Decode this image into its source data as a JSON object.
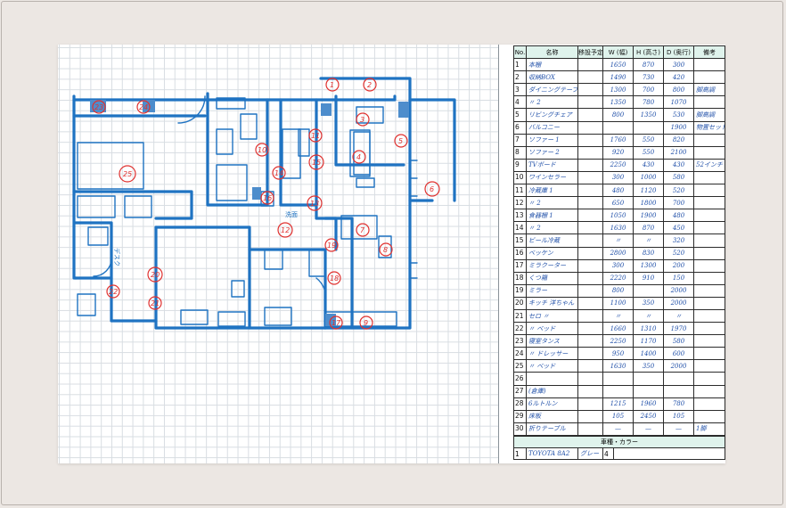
{
  "furniture_table": {
    "headers": [
      "No.",
      "名称",
      "移設予定",
      "W (幅)",
      "H (高さ)",
      "D (奥行)",
      "備考"
    ],
    "rows": [
      {
        "no": "1",
        "name": "本棚",
        "plan": "",
        "w": "1650",
        "h": "870",
        "d": "300",
        "note": ""
      },
      {
        "no": "2",
        "name": "収納BOX",
        "plan": "",
        "w": "1490",
        "h": "730",
        "d": "420",
        "note": ""
      },
      {
        "no": "3",
        "name": "ダイニングテーブル1",
        "plan": "",
        "w": "1300",
        "h": "700",
        "d": "800",
        "note": "脚高調"
      },
      {
        "no": "4",
        "name": "〃 2",
        "plan": "",
        "w": "1350",
        "h": "780",
        "d": "1070",
        "note": ""
      },
      {
        "no": "5",
        "name": "リビングチェア",
        "plan": "",
        "w": "800",
        "h": "1350",
        "d": "530",
        "note": "脚高調"
      },
      {
        "no": "6",
        "name": "バルコニー",
        "plan": "",
        "w": "",
        "h": "",
        "d": "1900",
        "note": "物置セット"
      },
      {
        "no": "7",
        "name": "ソファー 1",
        "plan": "",
        "w": "1760",
        "h": "550",
        "d": "820",
        "note": ""
      },
      {
        "no": "8",
        "name": "ソファー 2",
        "plan": "",
        "w": "920",
        "h": "550",
        "d": "2100",
        "note": ""
      },
      {
        "no": "9",
        "name": "TVボード",
        "plan": "",
        "w": "2250",
        "h": "430",
        "d": "430",
        "note": "52インチ"
      },
      {
        "no": "10",
        "name": "ワインセラー",
        "plan": "",
        "w": "300",
        "h": "1000",
        "d": "580",
        "note": ""
      },
      {
        "no": "11",
        "name": "冷蔵庫 1",
        "plan": "",
        "w": "480",
        "h": "1120",
        "d": "520",
        "note": ""
      },
      {
        "no": "12",
        "name": "〃 2",
        "plan": "",
        "w": "650",
        "h": "1800",
        "d": "700",
        "note": ""
      },
      {
        "no": "13",
        "name": "食器棚 1",
        "plan": "",
        "w": "1050",
        "h": "1900",
        "d": "480",
        "note": ""
      },
      {
        "no": "14",
        "name": "〃 2",
        "plan": "",
        "w": "1630",
        "h": "870",
        "d": "450",
        "note": ""
      },
      {
        "no": "15",
        "name": "ビール冷蔵",
        "plan": "",
        "w": "〃",
        "h": "〃",
        "d": "320",
        "note": ""
      },
      {
        "no": "16",
        "name": "ベッケン",
        "plan": "",
        "w": "2800",
        "h": "830",
        "d": "520",
        "note": ""
      },
      {
        "no": "17",
        "name": "ミラクーター",
        "plan": "",
        "w": "300",
        "h": "1300",
        "d": "200",
        "note": ""
      },
      {
        "no": "18",
        "name": "くつ箱",
        "plan": "",
        "w": "2220",
        "h": "910",
        "d": "150",
        "note": ""
      },
      {
        "no": "19",
        "name": "ミラー",
        "plan": "",
        "w": "800",
        "h": "",
        "d": "2000",
        "note": ""
      },
      {
        "no": "20",
        "name": "キッチ 洋ちゃん",
        "plan": "",
        "w": "1100",
        "h": "350",
        "d": "2000",
        "note": ""
      },
      {
        "no": "21",
        "name": "セロ 〃",
        "plan": "",
        "w": "〃",
        "h": "〃",
        "d": "〃",
        "note": ""
      },
      {
        "no": "22",
        "name": "〃 ベッド",
        "plan": "",
        "w": "1660",
        "h": "1310",
        "d": "1970",
        "note": ""
      },
      {
        "no": "23",
        "name": "寝室タンス",
        "plan": "",
        "w": "2250",
        "h": "1170",
        "d": "580",
        "note": ""
      },
      {
        "no": "24",
        "name": "〃 ドレッサー",
        "plan": "",
        "w": "950",
        "h": "1400",
        "d": "600",
        "note": ""
      },
      {
        "no": "25",
        "name": "〃 ベッド",
        "plan": "",
        "w": "1630",
        "h": "350",
        "d": "2000",
        "note": ""
      },
      {
        "no": "26",
        "name": "",
        "plan": "",
        "w": "",
        "h": "",
        "d": "",
        "note": ""
      },
      {
        "no": "27",
        "name": "(倉庫)",
        "plan": "",
        "w": "",
        "h": "",
        "d": "",
        "note": ""
      },
      {
        "no": "28",
        "name": "6ルトルン",
        "plan": "",
        "w": "1215",
        "h": "1960",
        "d": "780",
        "note": ""
      },
      {
        "no": "29",
        "name": "床板",
        "plan": "",
        "w": "105",
        "h": "2450",
        "d": "105",
        "note": ""
      },
      {
        "no": "30",
        "name": "折りテーブル",
        "plan": "",
        "w": "—",
        "h": "—",
        "d": "—",
        "note": "1脚"
      }
    ]
  },
  "car_table": {
    "header": "車種・カラー",
    "rows": [
      {
        "no": "1",
        "model": "TOYOTA 8A2",
        "color": "グレー",
        "count": "4"
      }
    ]
  },
  "floor_plan": {
    "room_numbers": [
      "1",
      "2",
      "3",
      "4",
      "5",
      "6",
      "7",
      "8",
      "9",
      "10",
      "11",
      "12",
      "13",
      "14",
      "15",
      "16",
      "17",
      "18",
      "19",
      "20",
      "21",
      "22",
      "23",
      "24",
      "25"
    ],
    "labels": {
      "closet": "洗面",
      "desk": "デスク",
      "storage": "倉庫"
    },
    "colors": {
      "walls": "#1f73c2",
      "markers": "#e0312f",
      "header_bg": "#dff3ec"
    }
  }
}
